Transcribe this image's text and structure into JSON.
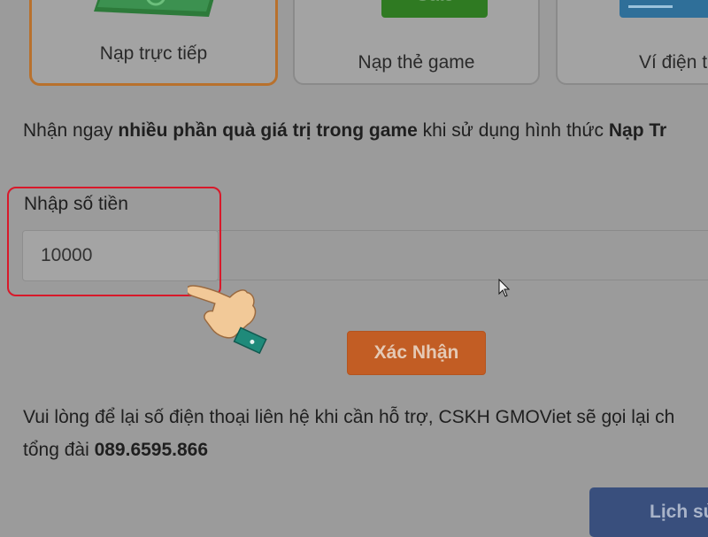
{
  "payment_methods": [
    {
      "label": "Nạp trực tiếp",
      "selected": true
    },
    {
      "label": "Nạp thẻ game",
      "image_text": "Gate"
    },
    {
      "label": "Ví điện t"
    }
  ],
  "intro": {
    "prefix": "Nhận ngay ",
    "bold1": "nhiều phần quà giá trị trong game",
    "middle": " khi sử dụng hình thức ",
    "bold2": "Nạp Tr"
  },
  "amount": {
    "label": "Nhập số tiền",
    "value": "10000"
  },
  "confirm_label": "Xác Nhận",
  "support": {
    "line1": "Vui lòng để lại số điện thoại liên hệ khi cần hỗ trợ, CSKH GMOViet sẽ gọi lại ch",
    "line2_prefix": "tổng đài ",
    "phone": "089.6595.866"
  },
  "history_label": "Lịch sử",
  "colors": {
    "selected_border": "#b8712d",
    "confirm_button": "#c25d24",
    "history_button": "#394f7d",
    "highlight_frame": "#d8192a"
  }
}
